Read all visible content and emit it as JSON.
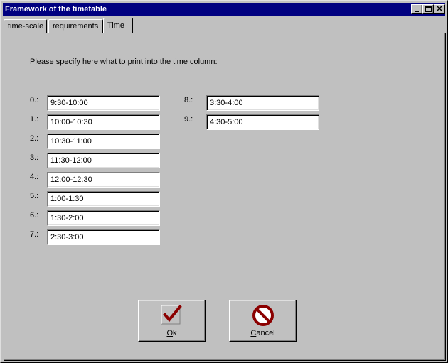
{
  "window": {
    "title": "Framework of the timetable"
  },
  "tabs": [
    {
      "label": "time-scale"
    },
    {
      "label": "requirements"
    },
    {
      "label": "Time"
    }
  ],
  "instruction": "Please specify here what to print into the time column:",
  "time_rows": [
    {
      "label": "0.:",
      "value": "9:30-10:00"
    },
    {
      "label": "1.:",
      "value": "10:00-10:30"
    },
    {
      "label": "2.:",
      "value": "10:30-11:00"
    },
    {
      "label": "3.:",
      "value": "11:30-12:00"
    },
    {
      "label": "4.:",
      "value": "12:00-12:30"
    },
    {
      "label": "5.:",
      "value": "1:00-1:30"
    },
    {
      "label": "6.:",
      "value": "1:30-2:00"
    },
    {
      "label": "7.:",
      "value": "2:30-3:00"
    },
    {
      "label": "8.:",
      "value": "3:30-4:00"
    },
    {
      "label": "9.:",
      "value": "4:30-5:00"
    }
  ],
  "buttons": {
    "ok": {
      "label_first": "O",
      "label_rest": "k",
      "icon": "checkmark-icon"
    },
    "cancel": {
      "label_first": "C",
      "label_rest": "ancel",
      "icon": "no-entry-icon"
    }
  },
  "colors": {
    "titlebar": "#000080",
    "face": "#c0c0c0",
    "icon_red": "#8b0000"
  }
}
